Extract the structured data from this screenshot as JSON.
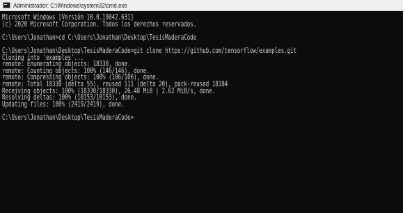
{
  "window": {
    "title": "Administrador: C:\\Windows\\system32\\cmd.exe",
    "icon": "cmd-icon"
  },
  "console": {
    "block1": [
      "Microsoft Windows [Versión 10.0.19042.631]",
      "(c) 2020 Microsoft Corporation. Todos los derechos reservados."
    ],
    "block2": [
      "C:\\Users\\Jonathan>cd C:\\Users\\Jonathan\\Desktop\\TesisMaderaCode"
    ],
    "block3": [
      "C:\\Users\\Jonathan\\Desktop\\TesisMaderaCode>git clone https://github.com/tensorflow/examples.git",
      "Cloning into 'examples'...",
      "remote: Enumerating objects: 18330, done.",
      "remote: Counting objects: 100% (146/146), done.",
      "remote: Compressing objects: 100% (106/106), done.",
      "remote: Total 18330 (delta 55), reused 111 (delta 20), pack-reused 18184",
      "Receiving objects: 100% (18330/18330), 26.48 MiB | 2.62 MiB/s, done.",
      "Resolving deltas: 100% (10153/10153), done.",
      "Updating files: 100% (2419/2419), done."
    ],
    "block4": [
      "C:\\Users\\Jonathan\\Desktop\\TesisMaderaCode>"
    ]
  }
}
